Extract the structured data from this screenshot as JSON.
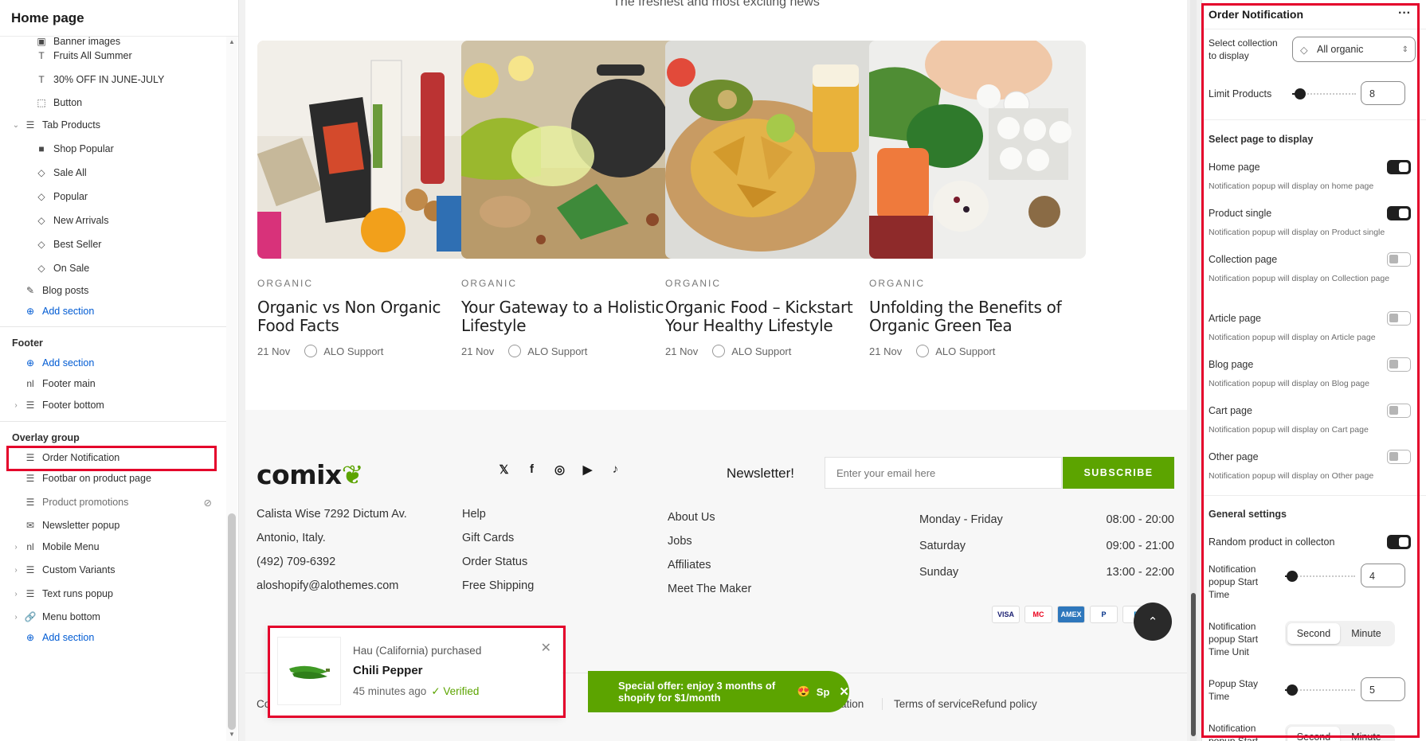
{
  "sidebar": {
    "title": "Home page",
    "items": {
      "banner_images": "Banner images",
      "fruits_summer": "Fruits All Summer",
      "off_june": "30% OFF IN JUNE-JULY",
      "button": "Button",
      "tab_products": "Tab Products",
      "shop_popular": "Shop Popular",
      "sale_all": "Sale All",
      "popular": "Popular",
      "new_arrivals": "New Arrivals",
      "best_seller": "Best Seller",
      "on_sale": "On Sale",
      "blog_posts": "Blog posts",
      "add_section": "Add section"
    },
    "footer": {
      "title": "Footer",
      "add_section": "Add section",
      "footer_main": "Footer main",
      "footer_bottom": "Footer bottom"
    },
    "overlay": {
      "title": "Overlay group",
      "order_notification": "Order Notification",
      "footbar": "Footbar on product page",
      "product_promotions": "Product promotions",
      "newsletter_popup": "Newsletter popup",
      "mobile_menu": "Mobile Menu",
      "custom_variants": "Custom Variants",
      "text_runs_popup": "Text runs popup",
      "menu_bottom": "Menu bottom",
      "add_section": "Add section"
    }
  },
  "preview": {
    "news_heading": "The freshest and most exciting news",
    "cards": [
      {
        "category": "ORGANIC",
        "title": "Organic vs Non Organic Food Facts",
        "date": "21 Nov",
        "author": "ALO Support"
      },
      {
        "category": "ORGANIC",
        "title": "Your Gateway to a Holistic Lifestyle",
        "date": "21 Nov",
        "author": "ALO Support"
      },
      {
        "category": "ORGANIC",
        "title": "Organic Food – Kickstart Your Healthy Lifestyle",
        "date": "21 Nov",
        "author": "ALO Support"
      },
      {
        "category": "ORGANIC",
        "title": "Unfolding the Benefits of Organic Green Tea",
        "date": "21 Nov",
        "author": "ALO Support"
      }
    ],
    "footer": {
      "logo": "comix",
      "address1": "Calista Wise 7292 Dictum Av.",
      "address2": "Antonio, Italy.",
      "phone": "(492) 709-6392",
      "email": "aloshopify@alothemes.com",
      "links1": [
        "Help",
        "Gift Cards",
        "Order Status",
        "Free Shipping"
      ],
      "links2": [
        "About Us",
        "Jobs",
        "Affiliates",
        "Meet The Maker"
      ],
      "newsletter_label": "Newsletter!",
      "email_placeholder": "Enter your email here",
      "subscribe": "SUBSCRIBE",
      "hours": [
        {
          "day": "Monday - Friday",
          "time": "08:00 - 20:00"
        },
        {
          "day": "Saturday",
          "time": "09:00 - 21:00"
        },
        {
          "day": "Sunday",
          "time": "13:00 - 22:00"
        }
      ],
      "payments": [
        "VISA",
        "MC",
        "AMEX",
        "P",
        "D"
      ],
      "bottom_left": "Co",
      "bottom_links": [
        "ation",
        "Terms of service",
        "Refund policy"
      ]
    },
    "offer": {
      "text": "Special offer: enjoy 3 months of shopify for $1/month",
      "more": "Sp"
    },
    "popup": {
      "line1": "Hau (California) purchased",
      "product": "Chili Pepper",
      "time": "45 minutes ago",
      "verified": "Verified"
    }
  },
  "panel": {
    "title": "Order Notification",
    "more": "···",
    "collection_label": "Select collection to display",
    "collection_value": "All organic",
    "limit_label": "Limit Products",
    "limit_value": "8",
    "limit_level": 0.12,
    "page_section": "Select page to display",
    "pages": [
      {
        "label": "Home page",
        "help": "Notification popup will display on home page",
        "on": true
      },
      {
        "label": "Product single",
        "help": "Notification popup will display on Product single",
        "on": true
      },
      {
        "label": "Collection page",
        "help": "Notification popup will display on Collection page",
        "on": false
      },
      {
        "label": "Article page",
        "help": "Notification popup will display on Article page",
        "on": false
      },
      {
        "label": "Blog page",
        "help": "Notification popup will display on Blog page",
        "on": false
      },
      {
        "label": "Cart page",
        "help": "Notification popup will display on Cart page",
        "on": false
      },
      {
        "label": "Other page",
        "help": "Notification popup will display on Other page",
        "on": false
      }
    ],
    "general": "General settings",
    "random_label": "Random product in collecton",
    "random_on": true,
    "start_time_label": "Notification popup Start Time",
    "start_time_value": "4",
    "unit_label": "Notification popup Start Time Unit",
    "unit_second": "Second",
    "unit_minute": "Minute",
    "stay_label": "Popup Stay Time",
    "stay_value": "5",
    "next_label": "Notification popup Start",
    "next_second": "Second",
    "next_minute": "Minute"
  },
  "colors": {
    "accent": "#5ca400",
    "highlight": "#e4002b",
    "link": "#005bd3"
  }
}
